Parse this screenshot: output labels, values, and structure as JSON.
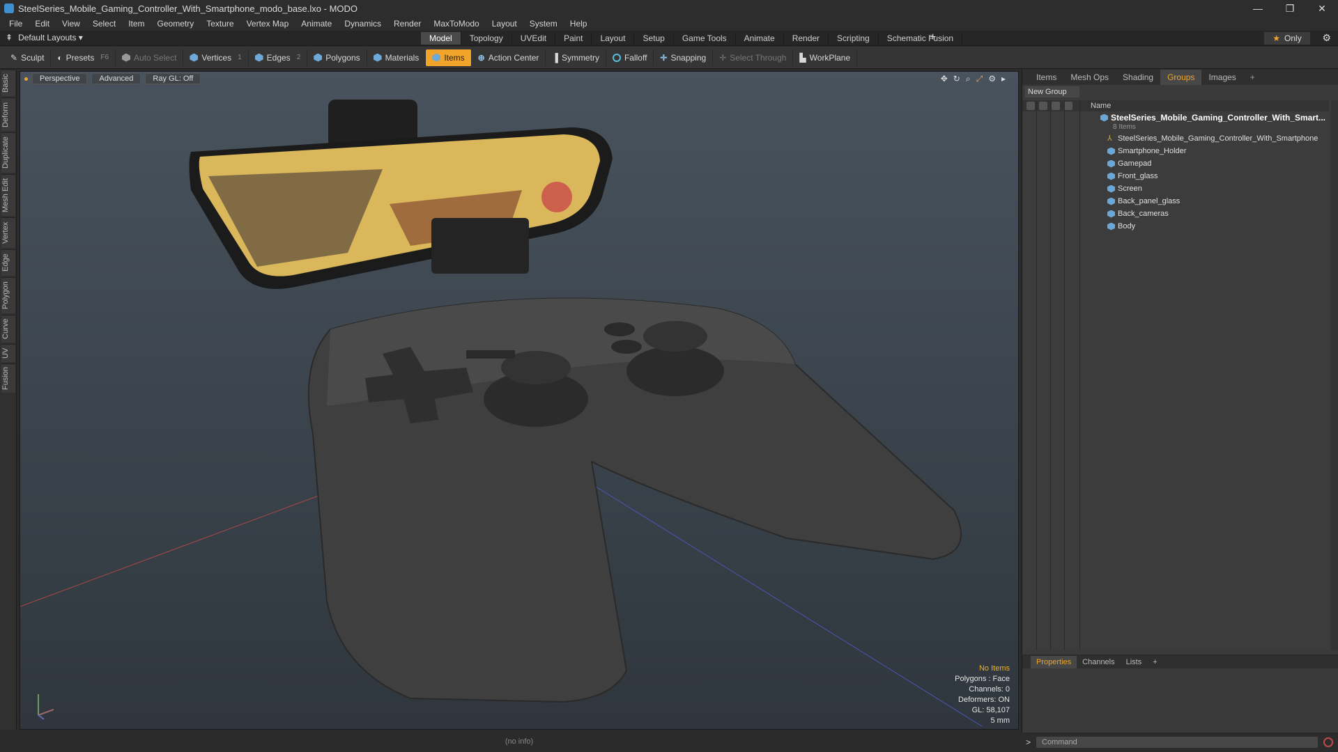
{
  "window": {
    "title": "SteelSeries_Mobile_Gaming_Controller_With_Smartphone_modo_base.lxo - MODO",
    "minimize": "—",
    "restore": "❐",
    "close": "✕"
  },
  "menu": [
    "File",
    "Edit",
    "View",
    "Select",
    "Item",
    "Geometry",
    "Texture",
    "Vertex Map",
    "Animate",
    "Dynamics",
    "Render",
    "MaxToModo",
    "Layout",
    "System",
    "Help"
  ],
  "layoutbar": {
    "default_layout": "Default Layouts ▾",
    "tabs": [
      "Model",
      "Topology",
      "UVEdit",
      "Paint",
      "Layout",
      "Setup",
      "Game Tools",
      "Animate",
      "Render",
      "Scripting",
      "Schematic Fusion"
    ],
    "active_tab": "Model",
    "add": "+",
    "only": "Only",
    "star": "★",
    "gear": "⚙"
  },
  "toolbar": {
    "sculpt": "Sculpt",
    "presets": "Presets",
    "presets_key": "F6",
    "auto_select": "Auto Select",
    "vertices": "Vertices",
    "vertices_count": "1",
    "edges": "Edges",
    "edges_count": "2",
    "polygons": "Polygons",
    "materials": "Materials",
    "items": "Items",
    "action_center": "Action Center",
    "symmetry": "Symmetry",
    "falloff": "Falloff",
    "snapping": "Snapping",
    "select_through": "Select Through",
    "workplane": "WorkPlane"
  },
  "left_tabs": [
    "Basic",
    "Deform",
    "Duplicate",
    "Mesh Edit",
    "Vertex",
    "Edge",
    "Polygon",
    "Curve",
    "UV",
    "Fusion"
  ],
  "viewport": {
    "perspective": "Perspective",
    "advanced": "Advanced",
    "raygl": "Ray GL: Off",
    "stats": {
      "no_items": "No Items",
      "polygons": "Polygons : Face",
      "channels": "Channels: 0",
      "deformers": "Deformers: ON",
      "gl": "GL: 58,107",
      "scale": "5 mm"
    }
  },
  "statusbar": {
    "info": "(no info)"
  },
  "right_panel": {
    "tabs": [
      "Items",
      "Mesh Ops",
      "Shading",
      "Groups",
      "Images"
    ],
    "active_tab": "Groups",
    "add": "+",
    "new_group": "New Group",
    "name_header": "Name",
    "group": {
      "name": "SteelSeries_Mobile_Gaming_Controller_With_Smart...",
      "count": "8 Items",
      "items": [
        {
          "name": "SteelSeries_Mobile_Gaming_Controller_With_Smartphone",
          "icon": "locator-icon"
        },
        {
          "name": "Smartphone_Holder",
          "icon": "mesh-icon"
        },
        {
          "name": "Gamepad",
          "icon": "mesh-icon"
        },
        {
          "name": "Front_glass",
          "icon": "mesh-icon"
        },
        {
          "name": "Screen",
          "icon": "mesh-icon"
        },
        {
          "name": "Back_panel_glass",
          "icon": "mesh-icon"
        },
        {
          "name": "Back_cameras",
          "icon": "mesh-icon"
        },
        {
          "name": "Body",
          "icon": "mesh-icon"
        }
      ]
    }
  },
  "bottom_panel": {
    "tabs": [
      "Properties",
      "Channels",
      "Lists"
    ],
    "active_tab": "Properties",
    "add": "+"
  },
  "command": {
    "placeholder": "Command",
    "prompt": ">"
  },
  "colors": {
    "accent": "#f0a52a",
    "viewport_top": "#48535d",
    "panel": "#3a3a3a"
  }
}
